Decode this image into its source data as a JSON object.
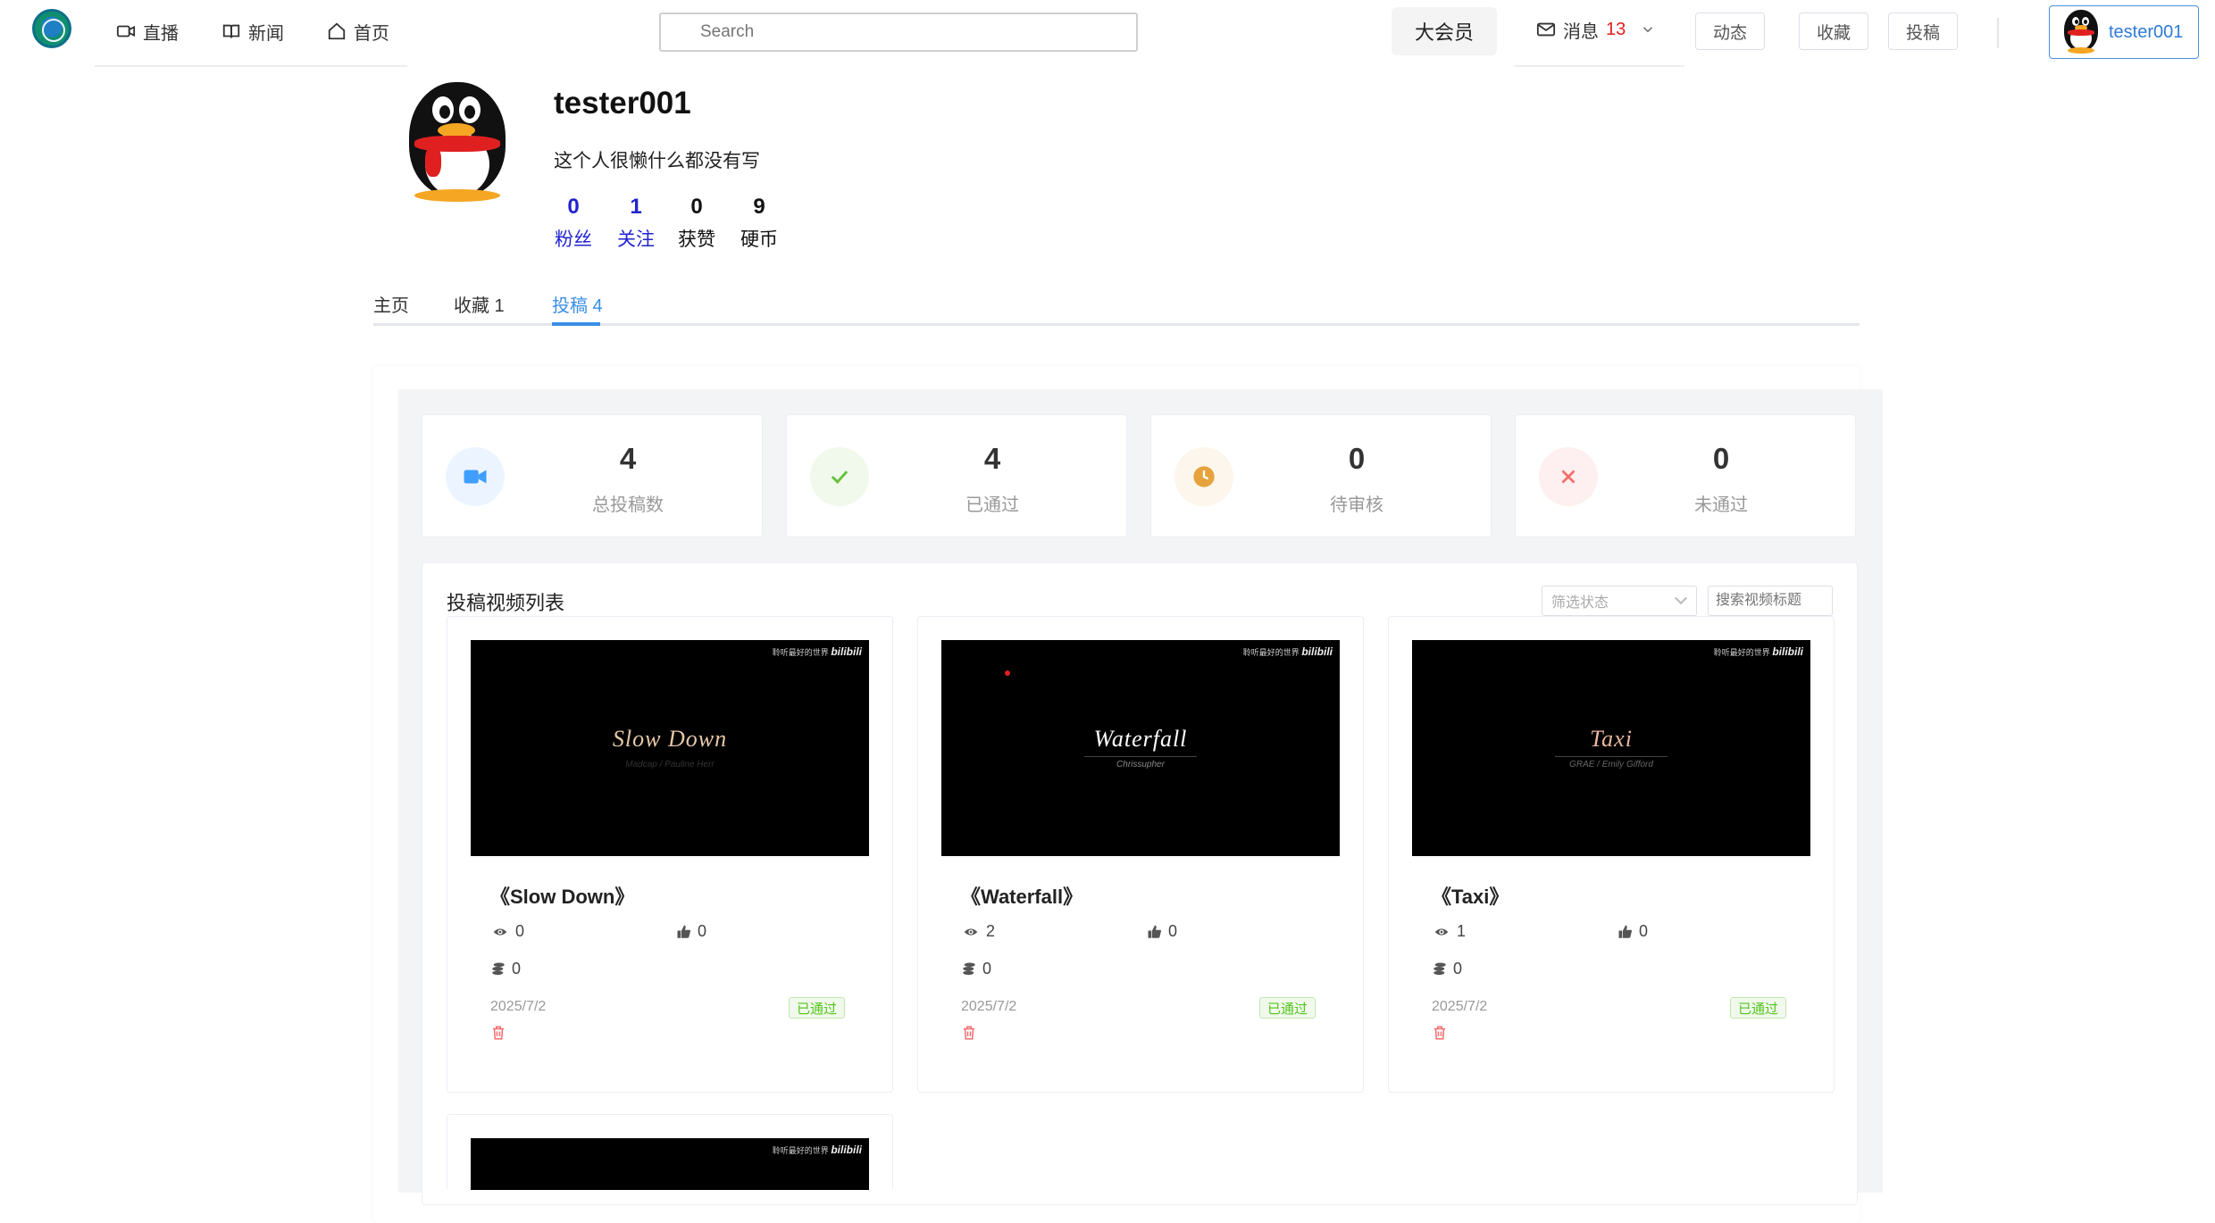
{
  "nav": {
    "items": [
      {
        "label": "直播",
        "icon": "video-camera-icon"
      },
      {
        "label": "新闻",
        "icon": "book-icon"
      },
      {
        "label": "首页",
        "icon": "home-icon"
      }
    ],
    "search_placeholder": "Search",
    "vip_label": "大会员",
    "messages_label": "消息",
    "messages_count": "13",
    "dynamic_label": "动态",
    "favorites_label": "收藏",
    "upload_label": "投稿",
    "username": "tester001"
  },
  "profile": {
    "name": "tester001",
    "bio": "这个人很懒什么都没有写",
    "stats": [
      {
        "value": "0",
        "label": "粉丝"
      },
      {
        "value": "1",
        "label": "关注"
      },
      {
        "value": "0",
        "label": "获赞"
      },
      {
        "value": "9",
        "label": "硬币"
      }
    ]
  },
  "tabs": [
    {
      "label": "主页"
    },
    {
      "label": "收藏 1"
    },
    {
      "label": "投稿 4",
      "active": true
    }
  ],
  "summary": [
    {
      "value": "4",
      "label": "总投稿数",
      "icon": "video-icon",
      "color": "#409eff"
    },
    {
      "value": "4",
      "label": "已通过",
      "icon": "check-icon",
      "color": "#67c23a"
    },
    {
      "value": "0",
      "label": "待审核",
      "icon": "clock-icon",
      "color": "#e6a23c"
    },
    {
      "value": "0",
      "label": "未通过",
      "icon": "close-icon",
      "color": "#f56c6c"
    }
  ],
  "list": {
    "title": "投稿视频列表",
    "filter_placeholder": "筛选状态",
    "search_placeholder": "搜索视频标题",
    "videos": [
      {
        "title": "《Slow Down》",
        "thumb_title": "Slow Down",
        "thumb_sub": "Madcap / Pauline Herr",
        "views": "0",
        "likes": "0",
        "coins": "0",
        "date": "2025/7/2",
        "status": "已通过"
      },
      {
        "title": "《Waterfall》",
        "thumb_title": "Waterfall",
        "thumb_sub": "Chrissupher",
        "views": "2",
        "likes": "0",
        "coins": "0",
        "date": "2025/7/2",
        "status": "已通过"
      },
      {
        "title": "《Taxi》",
        "thumb_title": "Taxi",
        "thumb_sub": "GRAE / Emily Gifford",
        "views": "1",
        "likes": "0",
        "coins": "0",
        "date": "2025/7/2",
        "status": "已通过"
      }
    ],
    "watermark_text": "聆听最好的世界",
    "watermark_brand": "bilibili"
  },
  "colors": {
    "accent": "#3a8ee6",
    "link_blue": "#2323d0",
    "badge_red": "#e02020",
    "success": "#52c41a",
    "delete": "#f56c6c"
  }
}
